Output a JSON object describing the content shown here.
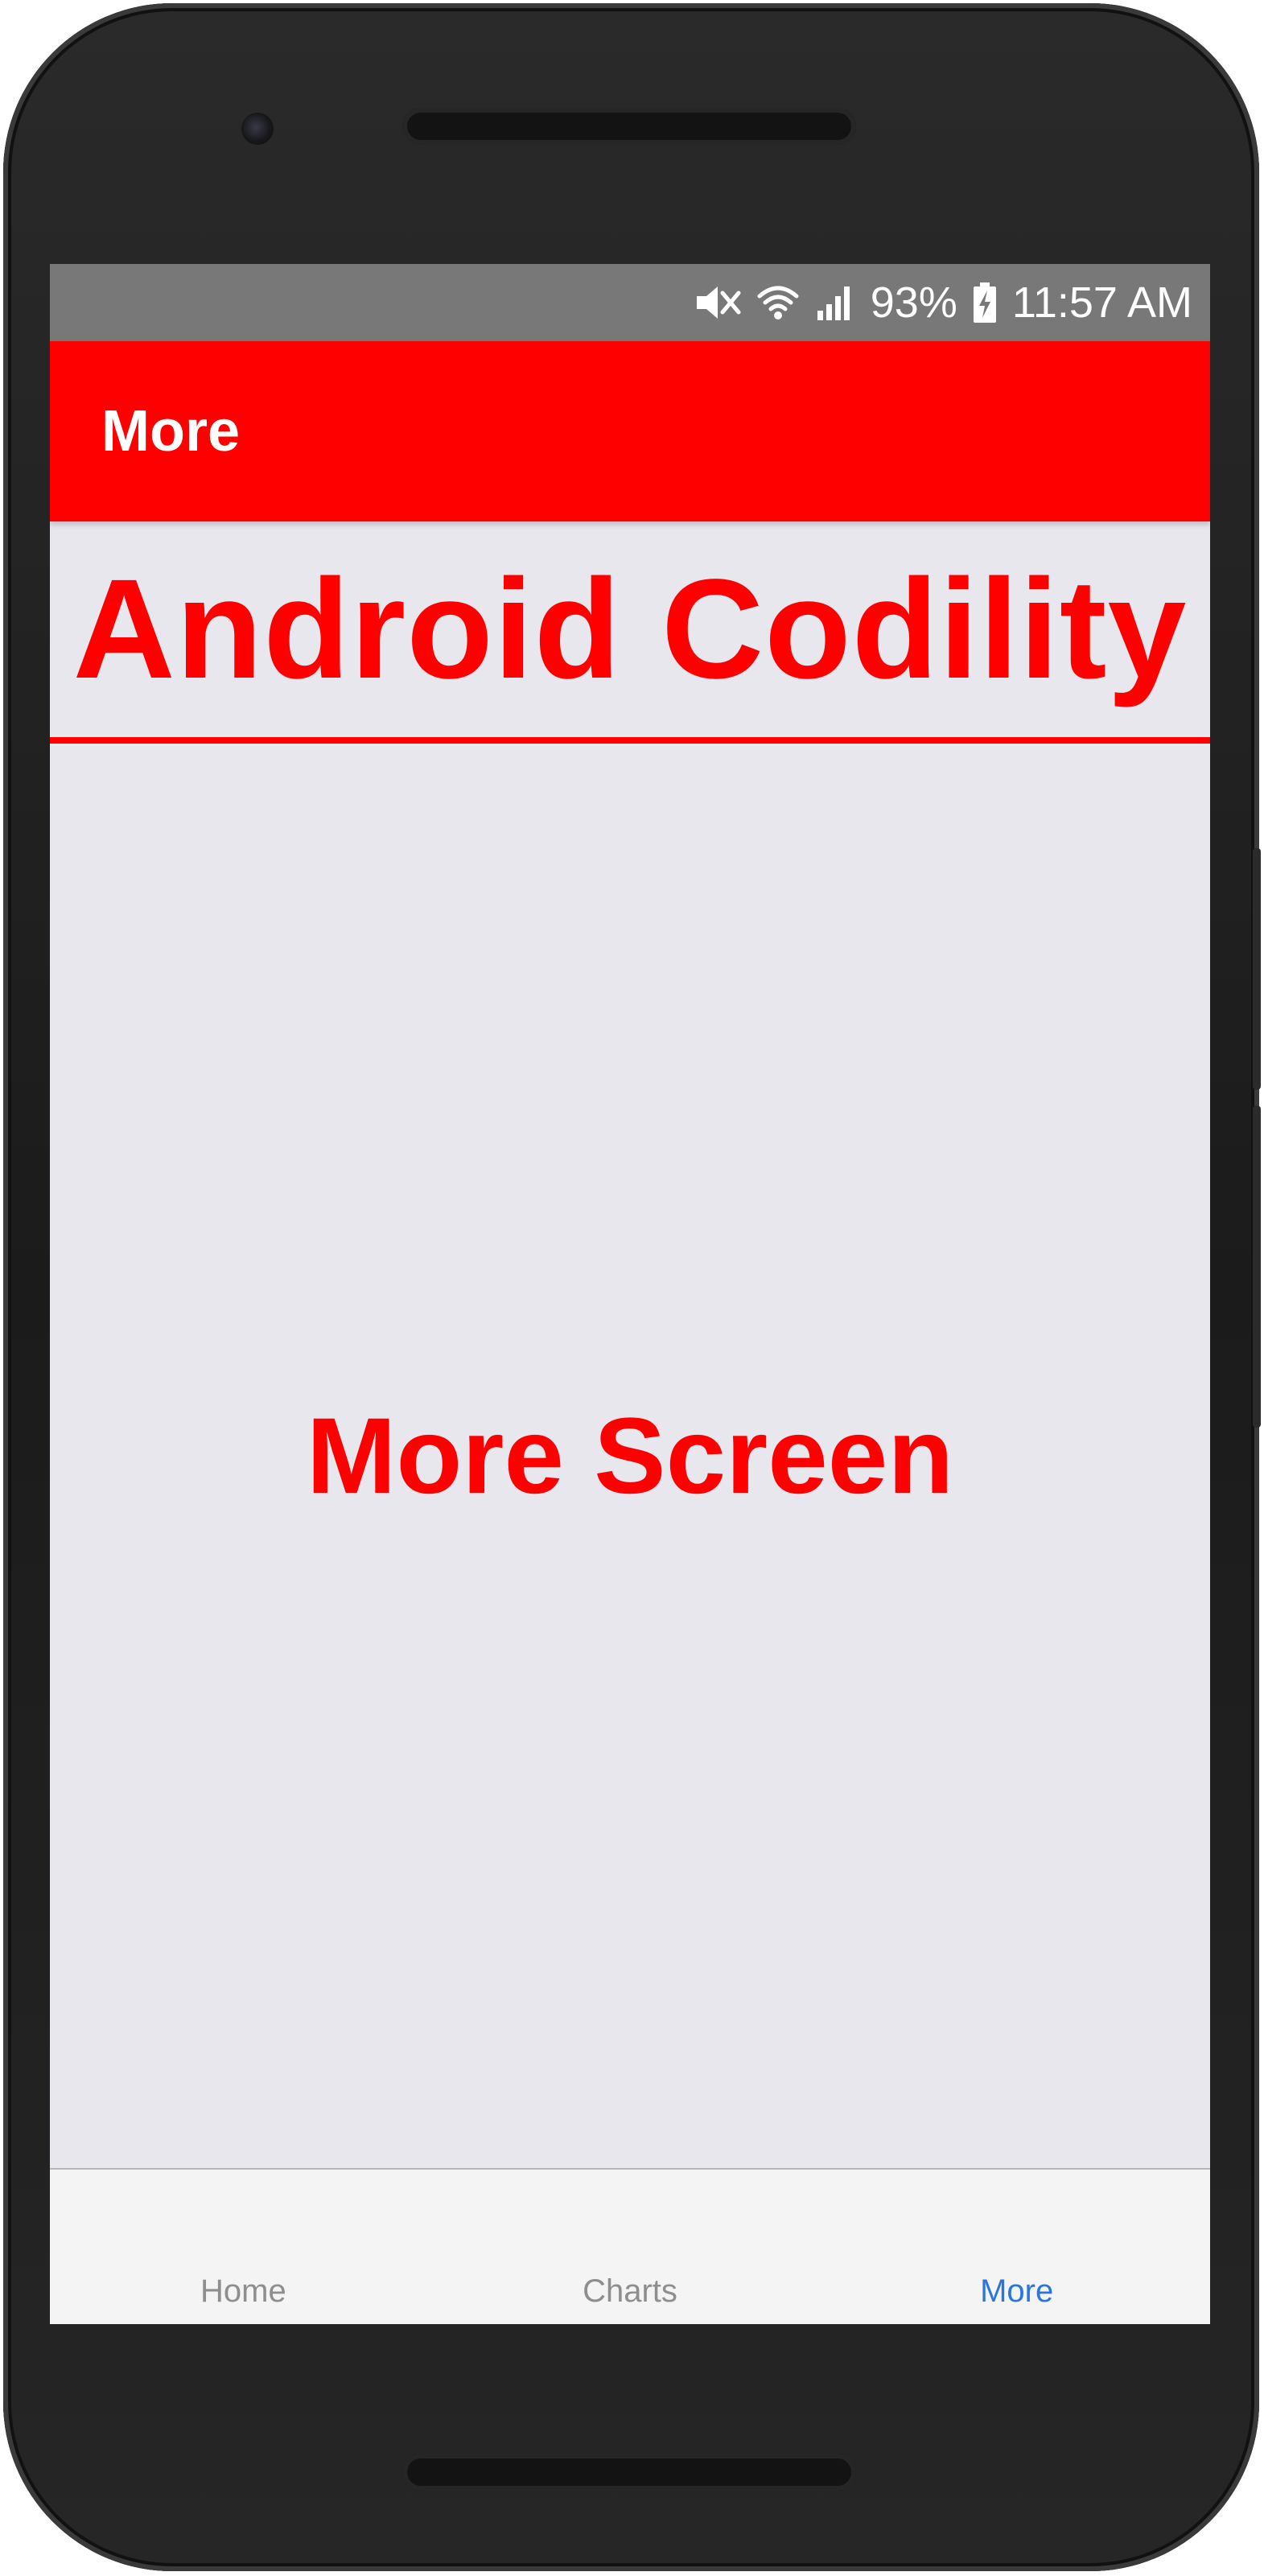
{
  "status_bar": {
    "icons": [
      "mute-icon",
      "wifi-icon",
      "signal-icon",
      "battery-charging-icon"
    ],
    "battery_percent": "93%",
    "time": "11:57 AM"
  },
  "app_bar": {
    "title": "More"
  },
  "header": {
    "brand": "Android Codility"
  },
  "content": {
    "screen_label": "More Screen"
  },
  "tab_bar": {
    "tabs": [
      {
        "label": "Home",
        "active": false
      },
      {
        "label": "Charts",
        "active": false
      },
      {
        "label": "More",
        "active": true
      }
    ]
  },
  "colors": {
    "accent": "#ff0000",
    "active_tab": "#2a75de",
    "inactive_tab": "#8e8e8e",
    "screen_background": "#e9e7ee",
    "status_bar": "#787878"
  }
}
